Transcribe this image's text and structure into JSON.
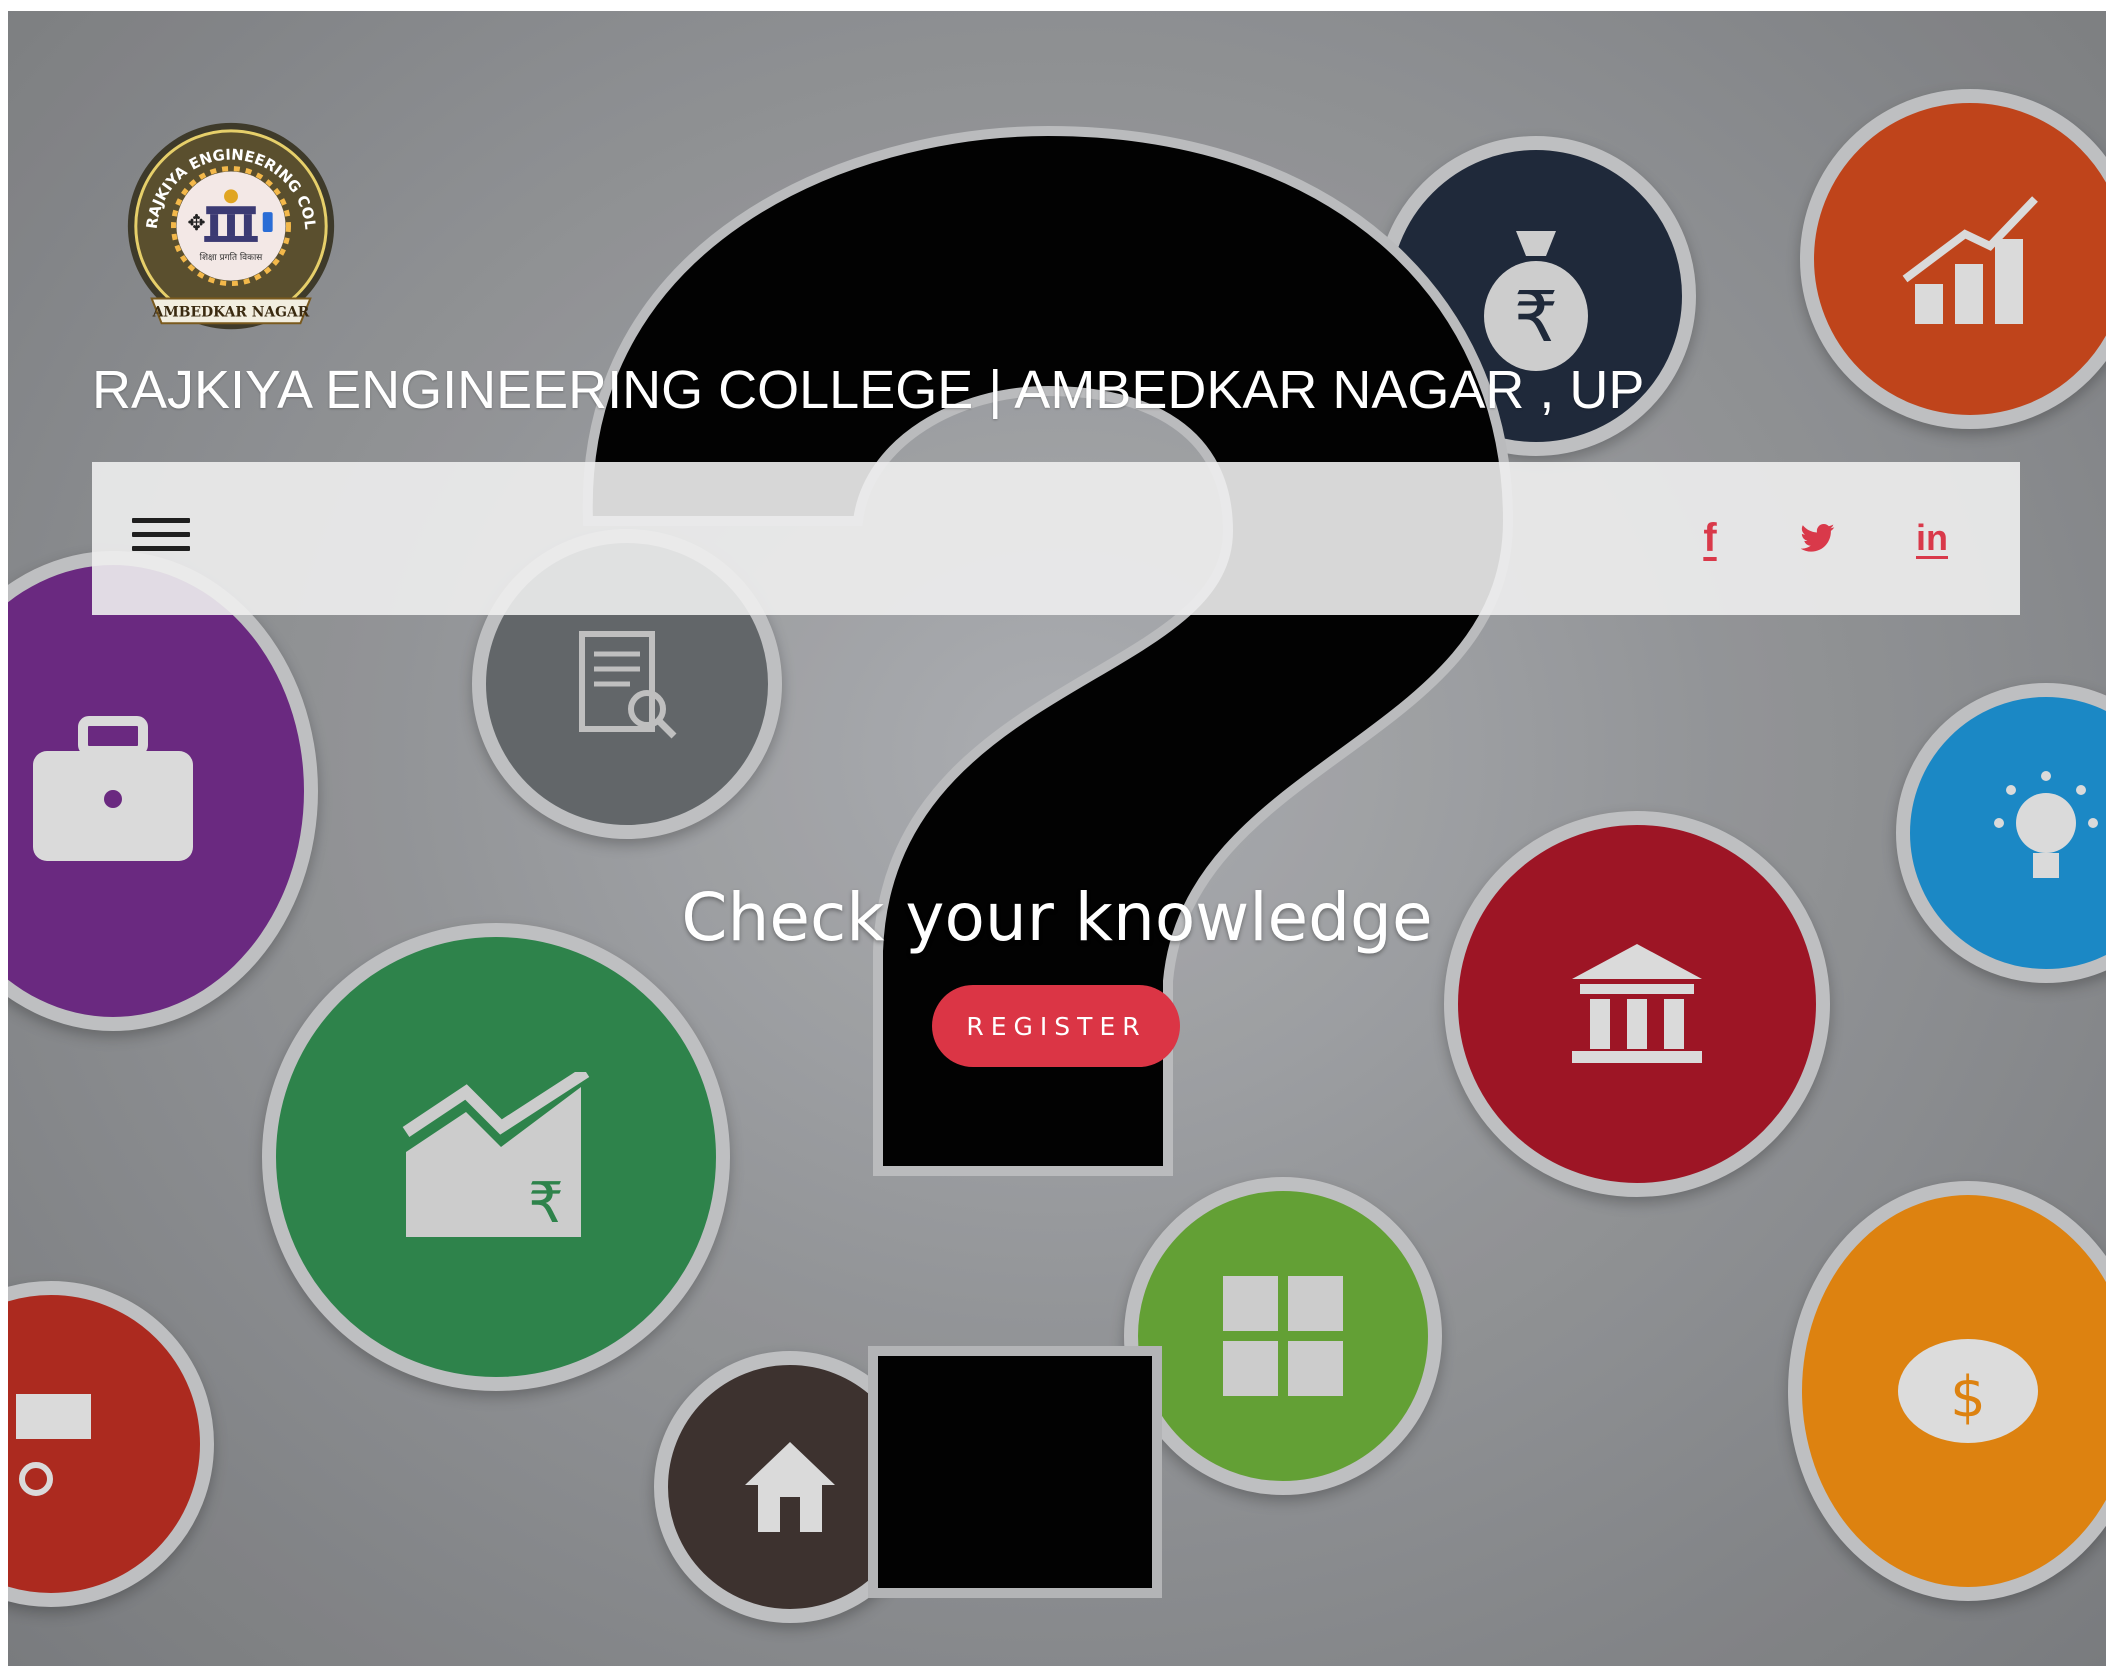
{
  "site": {
    "title": "RAJKIYA ENGINEERING COLLEGE | AMBEDKAR NAGAR , UP",
    "logo": {
      "ring_text": "RAJKIYA ENGINEERING COLLEGE",
      "motto": "शिक्षा प्रगति विकास",
      "banner": "AMBEDKAR NAGAR"
    }
  },
  "nav": {
    "menu_icon": "hamburger-icon",
    "social": [
      {
        "name": "facebook",
        "glyph": "f"
      },
      {
        "name": "twitter",
        "glyph": "twitter-bird"
      },
      {
        "name": "linkedin",
        "glyph": "in"
      }
    ]
  },
  "hero": {
    "heading": "Check your knowledge",
    "button_label": "REGISTER"
  },
  "colors": {
    "accent": "#db3545",
    "title": "#ffffff",
    "navbar_bg": "#eeeeee"
  }
}
